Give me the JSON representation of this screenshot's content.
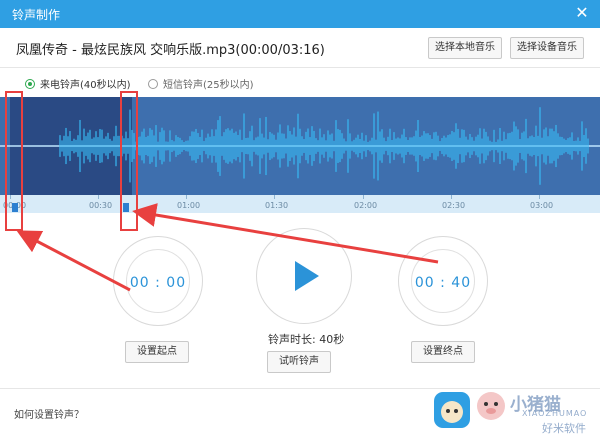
{
  "window": {
    "title": "铃声制作",
    "close_glyph": "✕"
  },
  "song": {
    "name": "凤凰传奇 - 最炫民族风 交响乐版.mp3(00:00/03:16)"
  },
  "buttons": {
    "choose_local": "选择本地音乐",
    "choose_device": "选择设备音乐",
    "set_start": "设置起点",
    "preview": "试听铃声",
    "set_end": "设置终点"
  },
  "modes": {
    "call": "来电铃声(40秒以内)",
    "sms": "短信铃声(25秒以内)"
  },
  "timeline": {
    "ticks": [
      "00:00",
      "00:30",
      "01:00",
      "01:30",
      "02:00",
      "02:30",
      "03:00"
    ]
  },
  "start_time": "00 : 00",
  "end_time": "00 : 40",
  "duration_text": "铃声时长: 40秒",
  "help_link": "如何设置铃声？",
  "watermark": {
    "brand": "小猪猫",
    "text": "XIAOZHUMAO",
    "sub": "好米软件"
  },
  "colors": {
    "accent": "#2f9fe3",
    "annotation": "#e8403f"
  }
}
